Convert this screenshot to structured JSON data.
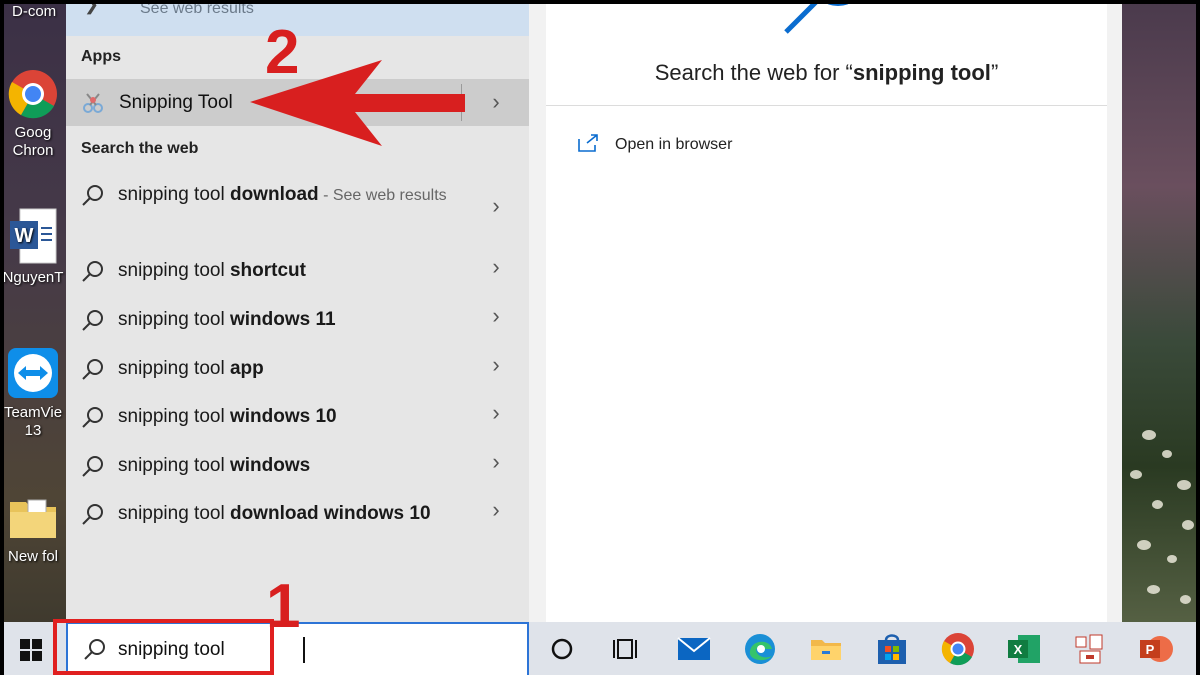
{
  "desktop": {
    "top_label": "D-com",
    "icons": [
      {
        "label_line1": "Goog",
        "label_line2": "Chron"
      },
      {
        "label_line1": "NguyenT",
        "label_line2": ""
      },
      {
        "label_line1": "TeamVie",
        "label_line2": "13"
      },
      {
        "label_line1": "New fol",
        "label_line2": ""
      }
    ]
  },
  "results": {
    "top_partial": "See web results",
    "apps_header": "Apps",
    "app_item": "Snipping Tool",
    "web_header": "Search the web",
    "web_items": [
      {
        "base": "snipping tool ",
        "bold": "download",
        "suffix": " - See web results"
      },
      {
        "base": "snipping tool ",
        "bold": "shortcut",
        "suffix": ""
      },
      {
        "base": "snipping tool ",
        "bold": "windows 11",
        "suffix": ""
      },
      {
        "base": "snipping tool ",
        "bold": "app",
        "suffix": ""
      },
      {
        "base": "snipping tool ",
        "bold": "windows 10",
        "suffix": ""
      },
      {
        "base": "snipping tool ",
        "bold": "windows",
        "suffix": ""
      },
      {
        "base": "snipping tool ",
        "bold": "download windows 10",
        "suffix": ""
      }
    ]
  },
  "preview": {
    "title_prefix": "Search the web for “",
    "title_query": "snipping tool",
    "title_suffix": "”",
    "open_browser": "Open in browser"
  },
  "taskbar": {
    "search_value": "snipping tool",
    "icons": [
      "cortana-icon",
      "task-view-icon",
      "mail-icon",
      "edge-icon",
      "file-explorer-icon",
      "store-icon",
      "chrome-icon",
      "excel-icon",
      "app-icon",
      "powerpoint-icon"
    ]
  },
  "annotations": {
    "step1": "1",
    "step2": "2"
  },
  "colors": {
    "annotation_red": "#d81f1f",
    "search_border": "#2d74d6",
    "highlight_row": "#cccccc"
  }
}
